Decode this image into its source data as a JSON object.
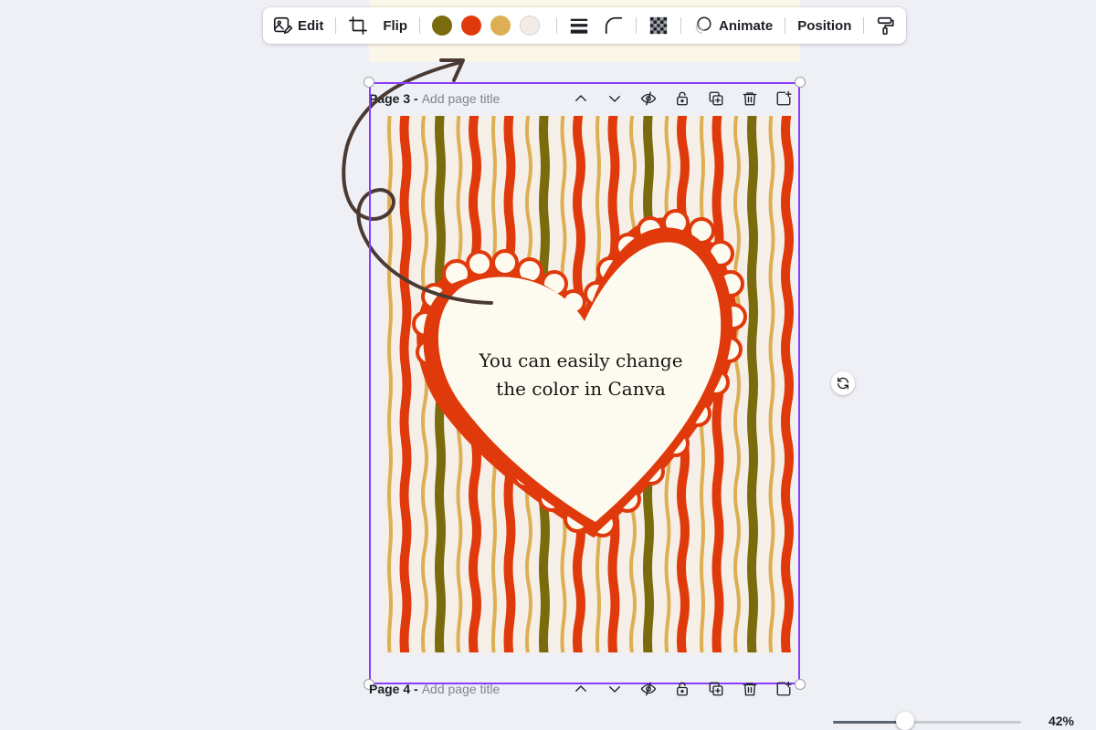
{
  "toolbar": {
    "edit_label": "Edit",
    "flip_label": "Flip",
    "animate_label": "Animate",
    "position_label": "Position",
    "icons": [
      "edit-image-icon",
      "crop-icon",
      "line-weight-icon",
      "corner-rounding-icon",
      "transparency-icon",
      "animate-icon",
      "copy-style-icon"
    ],
    "swatches": [
      "#7a6b0c",
      "#e03a0c",
      "#deae52",
      "#f3ece6"
    ]
  },
  "page3": {
    "label_prefix": "Page 3 - ",
    "title_placeholder": "Add page title"
  },
  "page4": {
    "label_prefix": "Page 4 - ",
    "title_placeholder": "Add page title"
  },
  "page_actions": [
    "chevron-up-icon",
    "chevron-down-icon",
    "hide-page-icon",
    "lock-icon",
    "duplicate-page-icon",
    "delete-icon",
    "add-page-icon"
  ],
  "design": {
    "text_line1": "You can easily change",
    "text_line2": "the color in Canva",
    "colors": {
      "background": "#f6efe7",
      "red": "#e03a0c",
      "olive": "#7a6b0c",
      "gold": "#deae52",
      "heart_fill": "#fdfbef",
      "arrow": "#4a3a33"
    }
  },
  "accent": "#8b3dff",
  "zoom": {
    "label": "42%",
    "value": 0.42
  }
}
